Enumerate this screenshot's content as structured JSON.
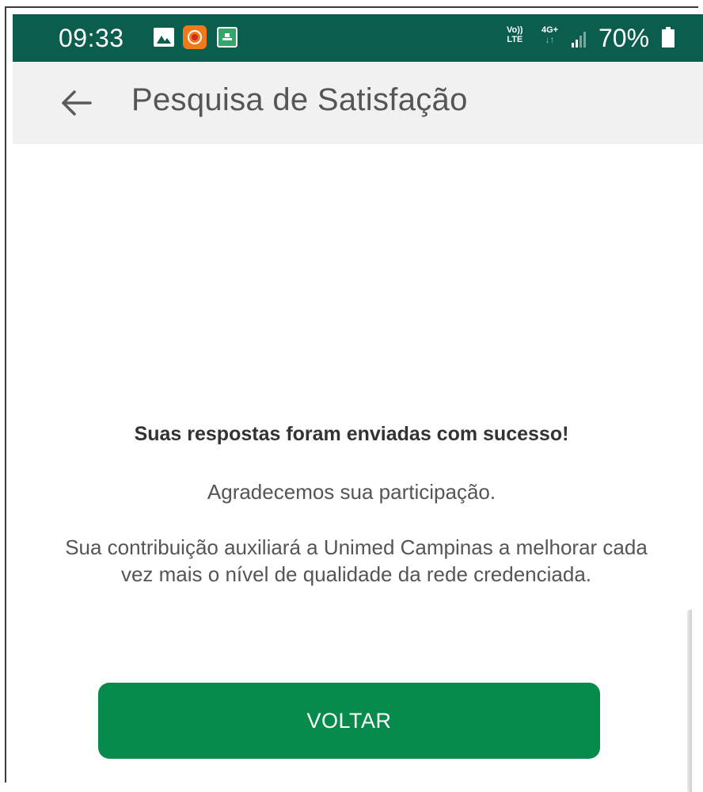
{
  "status_bar": {
    "time": "09:33",
    "volte_top": "Vo))",
    "volte_bottom": "LTE",
    "network_top": "4G+",
    "network_bottom": "↓↑",
    "battery_percent": "70%",
    "background_color": "#0b5d4e",
    "icons": [
      "gallery-icon",
      "screen-record-icon",
      "app-notification-icon",
      "volte-icon",
      "network-4g-icon",
      "signal-icon",
      "battery-icon"
    ]
  },
  "app_bar": {
    "title": "Pesquisa de Satisfação",
    "back_icon": "arrow-left-icon",
    "background_color": "#f1f1f1"
  },
  "content": {
    "success_title": "Suas respostas foram enviadas com sucesso!",
    "thanks_text": "Agradecemos sua participação.",
    "contribution_text": "Sua contribuição auxiliará a Unimed Campinas a melhorar cada vez mais o nível de qualidade da rede credenciada."
  },
  "button": {
    "label": "VOLTAR",
    "color": "#078b4c"
  }
}
